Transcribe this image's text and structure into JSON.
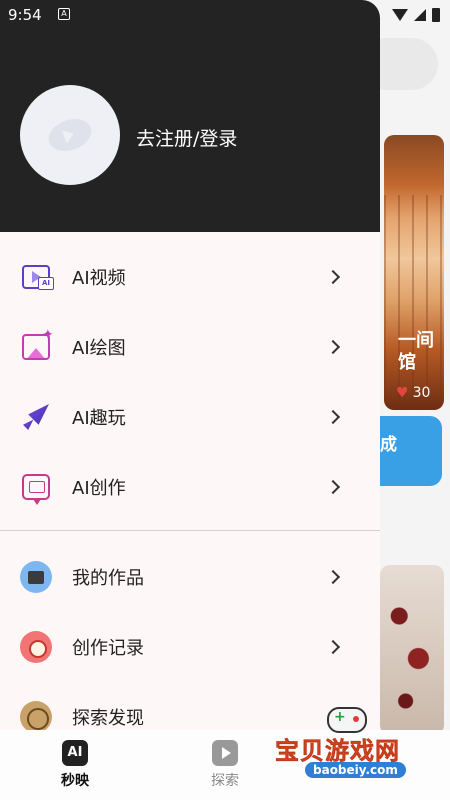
{
  "status_bar": {
    "time": "9:54",
    "notification": "A"
  },
  "background": {
    "card_text": "一间\n馆",
    "likes": "30",
    "blue_button": "成"
  },
  "drawer": {
    "login_label": "去注册/登录",
    "menu_top": [
      {
        "label": "AI视频",
        "icon": "ai-video-icon"
      },
      {
        "label": "AI绘图",
        "icon": "ai-drawing-icon"
      },
      {
        "label": "AI趣玩",
        "icon": "rocket-icon"
      },
      {
        "label": "AI创作",
        "icon": "ai-create-icon"
      }
    ],
    "menu_bottom": [
      {
        "label": "我的作品",
        "icon": "briefcase-icon"
      },
      {
        "label": "创作记录",
        "icon": "record-icon"
      },
      {
        "label": "探索发现",
        "icon": "compass-icon"
      }
    ]
  },
  "bottom_nav": {
    "items": [
      {
        "label": "秒映",
        "icon_text": "AI"
      },
      {
        "label": "探索"
      }
    ]
  },
  "watermark": {
    "title": "宝贝游戏网",
    "url": "baobeiy.com"
  },
  "colors": {
    "header_bg": "#232323",
    "drawer_bg": "#fdf8f7",
    "accent_purple": "#5b3fc4"
  }
}
